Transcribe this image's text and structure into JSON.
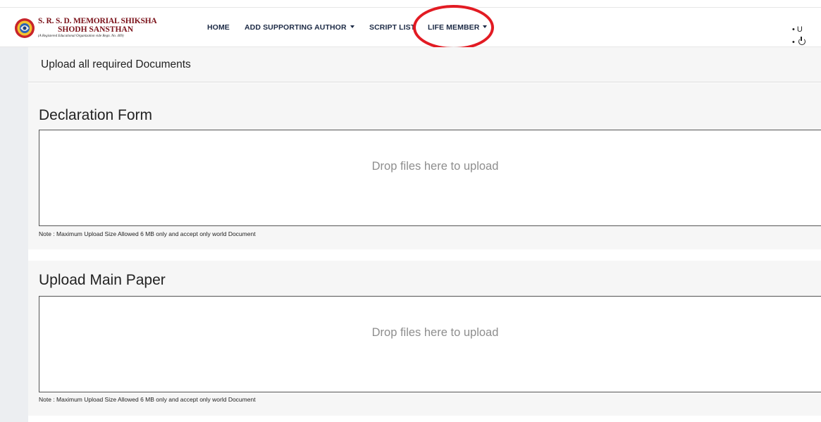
{
  "brand": {
    "name_line1": "S. R. S. D. MEMORIAL SHIKSHA",
    "name_line2": "SHODH SANSTHAN",
    "tagline": "(A Registered Educational Organization vide Regn. No. 409)"
  },
  "nav": {
    "home": "HOME",
    "add_supporting_author": "ADD SUPPORTING AUTHOR",
    "script_list": "SCRIPT LIST",
    "life_member": "LIFE MEMBER"
  },
  "user_menu": {
    "item1": "U"
  },
  "icons": {
    "power": "power-icon",
    "emblem": "logo-emblem-icon",
    "caret": "chevron-down-icon"
  },
  "colors": {
    "brand": "#7a1018",
    "nav_text": "#1c2a45",
    "highlight": "#e21b23"
  },
  "page": {
    "header": "Upload all required Documents"
  },
  "sections": [
    {
      "title": "Declaration Form",
      "dropzone_text": "Drop files here to upload",
      "note": "Note : Maximum Upload Size Allowed 6 MB only and accept only world Document"
    },
    {
      "title": "Upload Main Paper",
      "dropzone_text": "Drop files here to upload",
      "note": "Note : Maximum Upload Size Allowed 6 MB only and accept only world Document"
    }
  ]
}
